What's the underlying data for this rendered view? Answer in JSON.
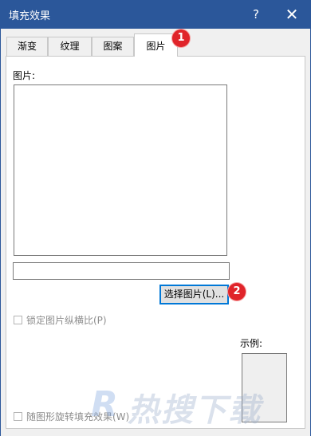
{
  "window": {
    "title": "填充效果",
    "help_label": "?",
    "close_label": "✕"
  },
  "tabs": [
    {
      "label": "渐变",
      "active": false
    },
    {
      "label": "纹理",
      "active": false
    },
    {
      "label": "图案",
      "active": false
    },
    {
      "label": "图片",
      "active": true
    }
  ],
  "badges": {
    "one": "1",
    "two": "2"
  },
  "picture_section": {
    "label": "图片:",
    "filename_value": "",
    "select_button_label": "选择图片(L)..."
  },
  "options": {
    "lock_aspect_label": "锁定图片纵横比(P)",
    "rotate_with_shape_label": "随图形旋转填充效果(W)"
  },
  "sample": {
    "label": "示例:"
  },
  "watermark": {
    "text": "热搜下载",
    "mark": "R"
  },
  "colors": {
    "titlebar": "#2b579a",
    "badge": "#e0242a",
    "focus": "#0078d7"
  }
}
